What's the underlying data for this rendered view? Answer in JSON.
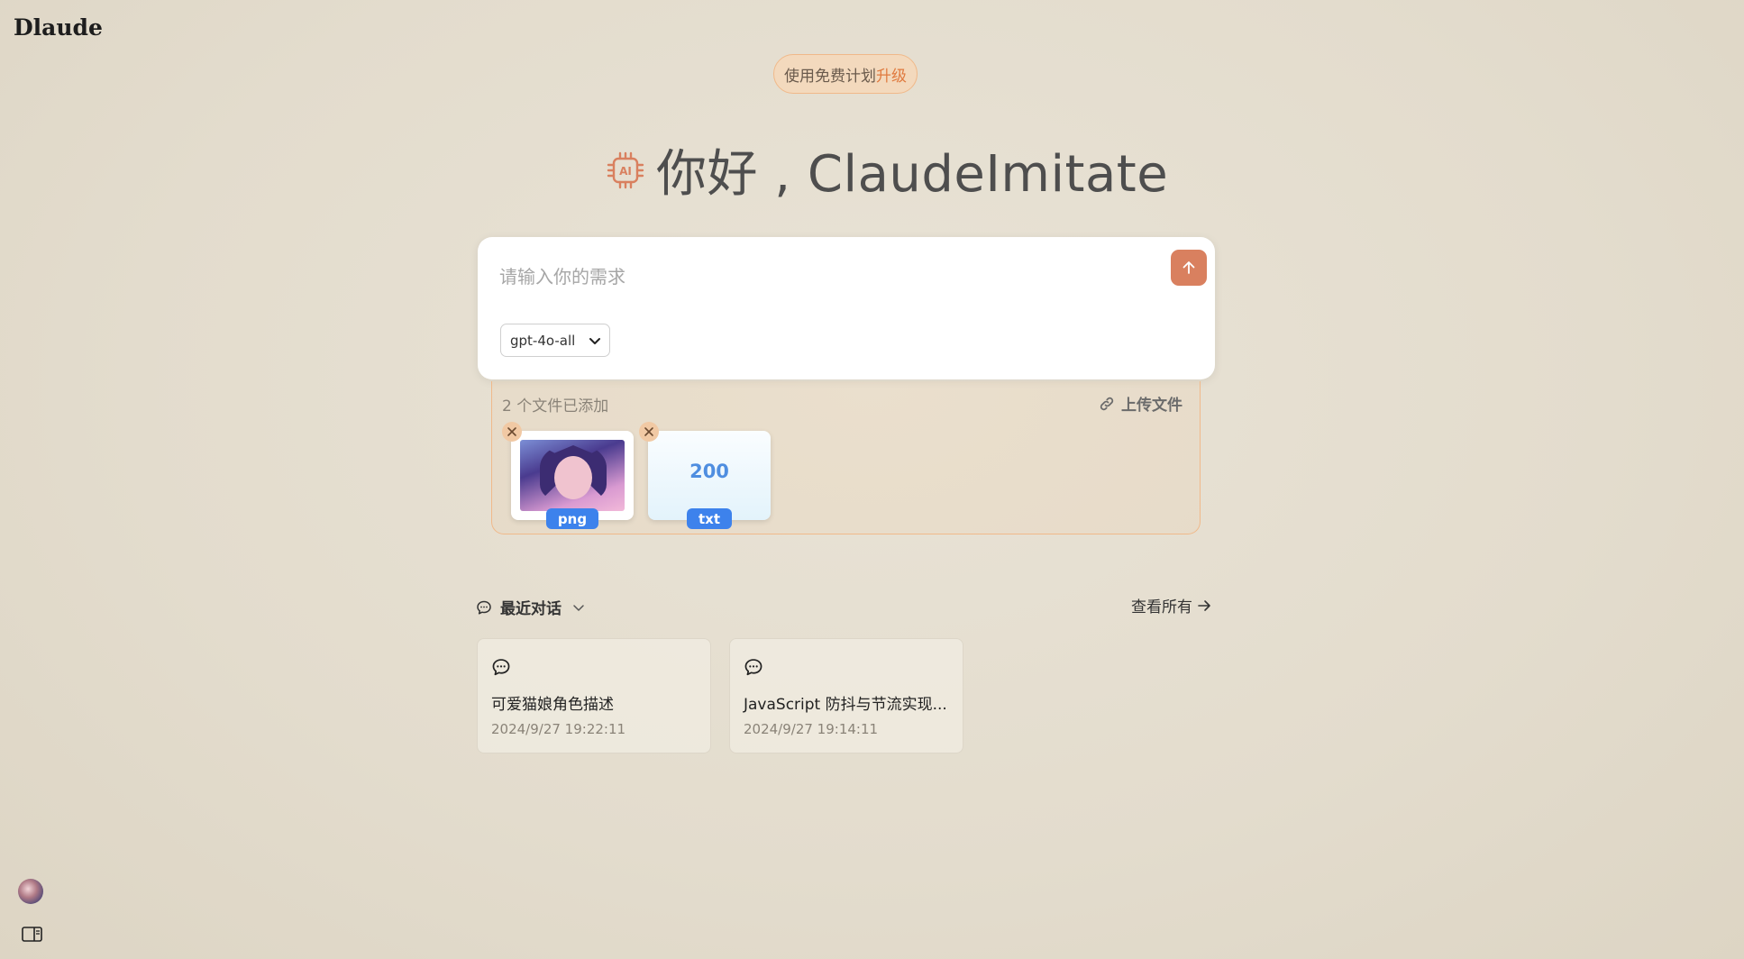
{
  "app": {
    "logo": "Dlaude"
  },
  "plan": {
    "text": "使用免费计划",
    "upgrade": "升级"
  },
  "greeting": {
    "chip_label": "AI",
    "text": "你好 , ClaudeImitate"
  },
  "composer": {
    "placeholder": "请输入你的需求",
    "model": "gpt-4o-all",
    "send_icon": "arrow-up-icon"
  },
  "files": {
    "count_label": "2 个文件已添加",
    "upload_label": "上传文件",
    "items": [
      {
        "type": "png"
      },
      {
        "type": "txt",
        "preview": "200"
      }
    ]
  },
  "recent": {
    "title": "最近对话",
    "view_all": "查看所有",
    "conversations": [
      {
        "title": "可爱猫娘角色描述",
        "time": "2024/9/27 19:22:11"
      },
      {
        "title": "JavaScript 防抖与节流实现...",
        "time": "2024/9/27 19:14:11"
      }
    ]
  },
  "colors": {
    "accent": "#d9805f",
    "upgrade": "#e07a3f",
    "badge": "#3d82ec"
  }
}
